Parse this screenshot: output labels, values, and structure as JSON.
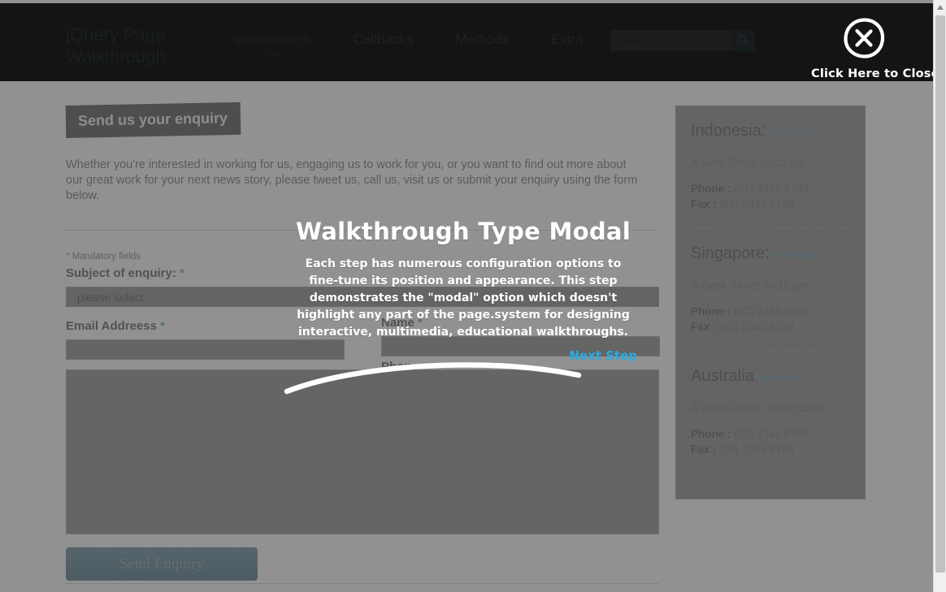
{
  "header": {
    "brand": "jQuery Page Walkthrough",
    "nav": [
      {
        "label": "Walkthrough",
        "active": true,
        "has_caret": true
      },
      {
        "label": "Callbacks",
        "active": false,
        "has_caret": false
      },
      {
        "label": "Methods",
        "active": false,
        "has_caret": false
      },
      {
        "label": "Extra",
        "active": false,
        "has_caret": false
      }
    ],
    "search": {
      "placeholder": "Search...",
      "value": "",
      "icon": "search-icon"
    },
    "close": {
      "label": "Click Here to Close",
      "icon": "circle-x-icon"
    },
    "colors": {
      "background": "#000000",
      "brand_text": "#2f7da3",
      "active_nav": "#2e7d00",
      "nav_text": "#9a9a9a",
      "search_button": "#18556e"
    }
  },
  "main": {
    "section_heading": "Send us your enquiry",
    "intro": "Whether you're interested in working for us, engaging us to work for you, or you want to find out more about our great work for your next news story, please tweet us, call us, visit us or submit your enquiry using the form below.",
    "form": {
      "mandatory_note": "Mandatory fields",
      "required_marker": "*",
      "subject": {
        "label": "Subject of enquiry:",
        "selected": "please select",
        "options": [
          "please select"
        ]
      },
      "email": {
        "label": "Email Addreess",
        "value": "",
        "placeholder": ""
      },
      "name": {
        "label": "Name",
        "value": "",
        "placeholder": ""
      },
      "phone": {
        "label": "Phone",
        "value": "",
        "placeholder": ""
      },
      "message": {
        "value": "",
        "placeholder": ""
      },
      "submit_label": "Send Enquiry"
    }
  },
  "contacts": {
    "view_map_label": "view map",
    "phone_label": "Phone :",
    "fax_label": "Fax :",
    "locations": [
      {
        "name": "Indonesia:",
        "address": "A Nerd Street 06/12 pm",
        "phone": "(01) 2345 6789",
        "fax": "(01) 2345 6789"
      },
      {
        "name": "Singapore:",
        "address": "A Geek Street 06/12 pm",
        "phone": "(02) 2345 6789",
        "fax": "(02) 2345 6789"
      },
      {
        "name": "Australia",
        "address": "A Lorem ipsum Street 123x",
        "phone": "(03) 2345 6789",
        "fax": "(03) 2345 6789"
      }
    ]
  },
  "walkthrough": {
    "title": "Walkthrough Type Modal",
    "body": "Each step has numerous configuration options to fine-tune its position and appearance. This step demonstrates the \"modal\" option which doesn't highlight any part of the page.system for designing interactive, multimedia, educational walkthroughs.",
    "next_label": "Next Step",
    "colors": {
      "text": "#ffffff",
      "next_link": "#29abe2",
      "overlay": "#666666"
    }
  }
}
